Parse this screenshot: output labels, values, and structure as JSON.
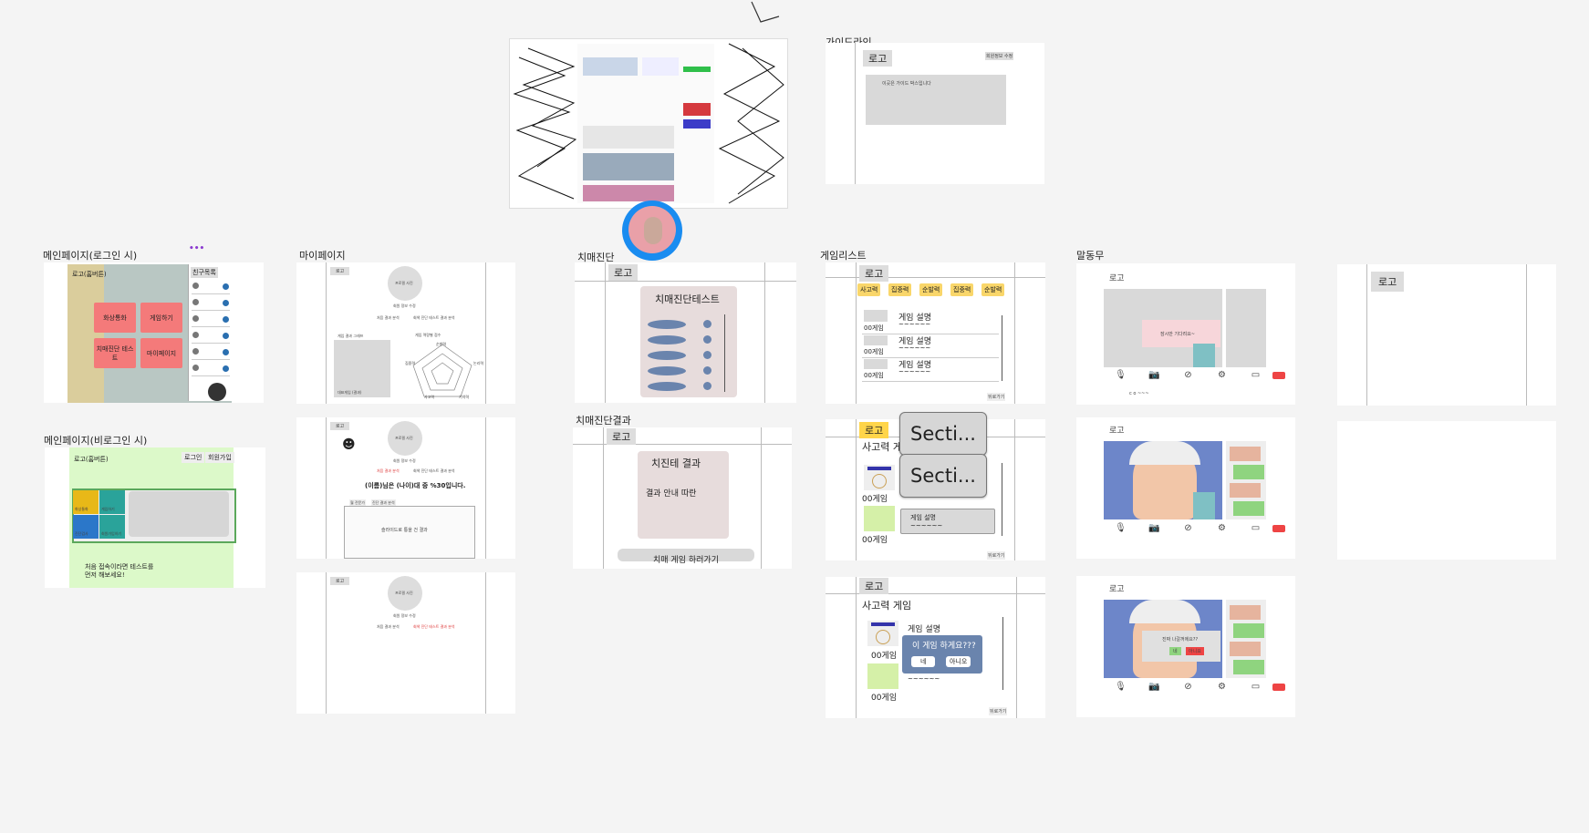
{
  "frames": {
    "guide": "가이드라인",
    "main_login": "메인페이지(로그인 시)",
    "main_guest": "메인페이지(비로그인 시)",
    "mypage": "마이페이지",
    "diag": "치매진단",
    "diag_result": "치매진단결과",
    "gamelist": "게임리스트",
    "talk": "말동무"
  },
  "common": {
    "logo": "로고",
    "logo_home": "로고(홈버튼)",
    "logo_home2": "로고(홈버튼)",
    "back": "뒤로가기",
    "profile_photo": "프로필 사진",
    "name_age": "회원 정보 수정"
  },
  "guide": {
    "top_right": "회원정보 수정",
    "content": "이곳은 가이드 박스입니다"
  },
  "main_login": {
    "btn_video": "화상통화",
    "btn_game": "게임하기",
    "btn_test": "치매진단 테스트",
    "btn_mypage": "마이페이지",
    "friends_header": "친구목록",
    "more": "•••"
  },
  "main_guest": {
    "login": "로그인",
    "signup": "회원가입",
    "tiles": [
      "화상통화",
      "게임하기",
      "진단검사",
      "회원가입하기"
    ],
    "message_line1": "처음 접속이라면 테스트를",
    "message_line2": "먼저 해보세요!"
  },
  "mypage": {
    "tab1": "처음 결과 분석",
    "tab2": "회색 진단 테스트 결과 분석",
    "graph_label": "게임 결과 그래프",
    "chart_title": "게임 역량별 점수",
    "radar_labels": [
      "순발력",
      "논리력",
      "기억력",
      "사고력",
      "집중력"
    ],
    "box_caption": "대표게임 (결과)",
    "result_sentence": "(이름)님은 (나이)대 중 %30입니다.",
    "slide_text": "슬라이드로 통을 건 결과",
    "mini_tabs": [
      "월 전문가",
      "진단 결과 분석"
    ]
  },
  "diag": {
    "title": "치매진단테스트"
  },
  "diag_result": {
    "title": "치진테 결과",
    "subtitle": "결과 안내 따란",
    "button": "치매 게임 하러가기"
  },
  "gamelist": {
    "chips": [
      "사고력",
      "집중력",
      "순발력",
      "집중력",
      "순발력"
    ],
    "game_desc": "게임 설명",
    "tilde": "~~~~~~",
    "game_name": "00게임",
    "category_title": "사고력 게임",
    "section1": "Secti...",
    "section2": "Secti...",
    "modal_question": "이 게임 하게요???",
    "modal_yes": "네",
    "modal_no": "아니오"
  },
  "talk": {
    "waiting": "잠시만 기다려요~",
    "exit_question": "진짜 나갈꺼에요??",
    "exit_yes": "네",
    "exit_no": "아니요",
    "extra": "c o ~~~"
  },
  "colors": {
    "pink_button": "#f47a7a",
    "chip_yellow": "#f9d66a",
    "pill_blue": "#6a84ad",
    "guest_bg": "#dcf9c9",
    "avatar_blue": "#1a8cf0"
  }
}
